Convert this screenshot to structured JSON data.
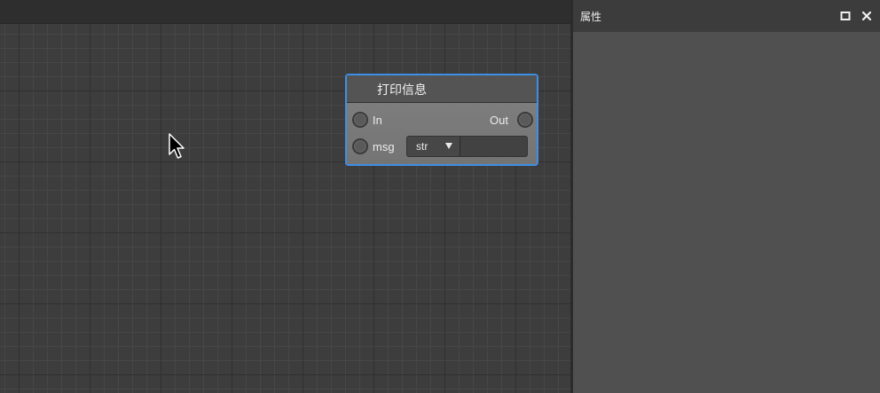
{
  "graph": {
    "node": {
      "title": "打印信息",
      "pins": {
        "in_label": "In",
        "out_label": "Out",
        "msg_label": "msg"
      },
      "type_select": {
        "selected": "str"
      },
      "msg_input": {
        "value": ""
      }
    }
  },
  "panel": {
    "title": "属性",
    "maximize_icon": "maximize-icon",
    "close_icon": "close-icon"
  },
  "colors": {
    "selection_accent": "#3d8fe6",
    "panel_background": "#505050",
    "canvas_background": "#3d3d3d"
  }
}
